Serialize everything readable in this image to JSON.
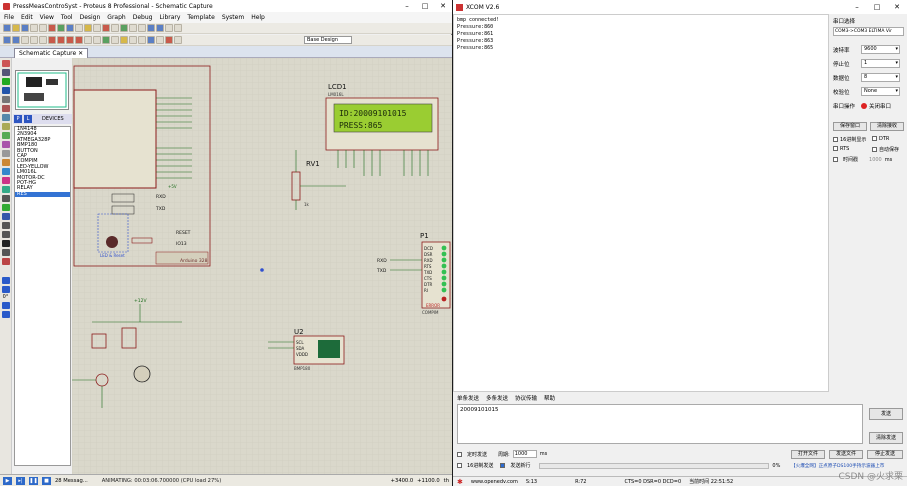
{
  "proteus": {
    "title": "PressMeasControSyst - Proteus 8 Professional - Schematic Capture",
    "menu": [
      "File",
      "Edit",
      "View",
      "Tool",
      "Design",
      "Graph",
      "Debug",
      "Library",
      "Template",
      "System",
      "Help"
    ],
    "design_select": "Base Design",
    "tab_label": "Schematic Capture",
    "device_tab_p": "P",
    "device_tab_l": "L",
    "devices_header": "DEVICES",
    "devices": [
      "1N4148",
      "2N3904",
      "ATMEGA328P",
      "BMP180",
      "BUTTON",
      "CAP",
      "COMPIM",
      "LED-YELLOW",
      "LM016L",
      "MOTOR-DC",
      "POT-HG",
      "RELAY",
      "RES"
    ],
    "selected_device": "RES",
    "rotation_value": "0°",
    "lcd_label": "LCD1",
    "lcd_part": "LM016L",
    "lcd_line1": "ID:20009101015",
    "lcd_line2": "PRESS:865",
    "rv1_label": "RV1",
    "rv1_value": "1k",
    "p1_label": "P1",
    "p1_part": "COMPIM",
    "p1_pins": [
      "DCD",
      "DSR",
      "RXD",
      "RTS",
      "TXD",
      "CTS",
      "DTR",
      "RI"
    ],
    "p1_error": "ERROR",
    "u2_label": "U2",
    "u2_part": "BMP180",
    "u2_pins": [
      "SCL",
      "SDA",
      "VDDD"
    ],
    "arduino_label": "Arduino 328",
    "rxd_label": "RXD",
    "txd_label": "TXD",
    "reset_label": "RESET",
    "io_label": "IO13",
    "led_label": "LED & Reset",
    "vcc_label": "+5V",
    "v12_label": "+12V",
    "text_tag": "<TEXT>",
    "status_messages": "28 Messag...",
    "status_anim": "ANIMATING: 00:03:06.700000 (CPU load 27%)",
    "status_x": "+3400.0",
    "status_y": "+1100.0",
    "status_unit": "th"
  },
  "xcom": {
    "title": "XCOM V2.6",
    "receive_lines": [
      "bmp connected!",
      "Pressure:860",
      "Pressure:861",
      "Pressure:863",
      "Pressure:865"
    ],
    "port_label": "串口选择",
    "port_value": "COM3:USB-SERIAL CH340",
    "port_value_shown": "COM3->COM3 ELTIMA Vir",
    "baud_label": "波特率",
    "baud_value": "9600",
    "stop_label": "停止位",
    "stop_value": "1",
    "data_label": "数据位",
    "data_value": "8",
    "parity_label": "校验位",
    "parity_value": "None",
    "op_label": "串口操作",
    "op_button": "关闭串口",
    "save_window": "保存窗口",
    "clear_recv": "清除接收",
    "hex_display": "16进制显示",
    "dtr": "DTR",
    "rts": "RTS",
    "auto_save": "自动保存",
    "timestamp": "时间戳",
    "timestamp_value": "1000",
    "timestamp_unit": "ms",
    "tabs": [
      "单条发送",
      "多条发送",
      "协议传输",
      "帮助"
    ],
    "send_text": "20009101015",
    "send_button": "发送",
    "clear_send": "清除发送",
    "timed_send": "定时发送",
    "period_label": "周期:",
    "period_value": "1000",
    "period_unit": "ms",
    "hex_send": "16进制发送",
    "send_newline": "发送新行",
    "open_file": "打开文件",
    "send_file": "发送文件",
    "stop_send": "停止发送",
    "progress_value": "0%",
    "ad_text": "【火爆全网】正点原子DS100手持示波器上市",
    "status_url": "www.openedv.com",
    "status_s": "S:13",
    "status_r": "R:72",
    "status_lines": "CTS=0 DSR=0 DCD=0",
    "status_time": "当前时间 22:51:52",
    "watermark": "CSDN @火求栗"
  },
  "colors": {
    "canvas_bg": "#dad8cb",
    "wire": "#1a6b1a",
    "component": "#8b1a1a",
    "lcd_bg": "#9acd32",
    "accent_blue": "#3373d4"
  }
}
